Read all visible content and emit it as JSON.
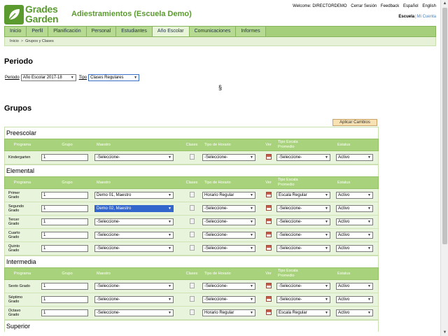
{
  "header": {
    "logo_line1": "Grades",
    "logo_line2": "Garden",
    "app_title": "Adiestramientos (Escuela Demo)",
    "welcome": "Welcome: DIRECTORDEMO",
    "logout": "Cerrar Sesión",
    "feedback": "Feedback",
    "lang_es": "Español",
    "lang_en": "English",
    "school_label": "Escuela",
    "account_label": "Mi Cuenta"
  },
  "nav": {
    "items": [
      {
        "label": "Inicio"
      },
      {
        "label": "Perfil"
      },
      {
        "label": "Planificación"
      },
      {
        "label": "Personal"
      },
      {
        "label": "Estudiantes"
      },
      {
        "label": "Año Escolar"
      },
      {
        "label": "Comunicaciones"
      },
      {
        "label": "Informes"
      }
    ],
    "active": "Año Escolar"
  },
  "breadcrumb": {
    "home": "Inicio",
    "current": "Grupos y Clases"
  },
  "periodo": {
    "heading": "Periodo",
    "periodo_label": "Periodo",
    "periodo_value": "Año Escolar 2017-18",
    "tipo_label": "Tipo",
    "tipo_value": "Clases Regulares",
    "section_mark": "§"
  },
  "grupos": {
    "heading": "Grupos",
    "apply_button": "Aplicar Cambios",
    "columns": {
      "programa": "Programa",
      "grupo": "Grupo",
      "maestro": "Maestro",
      "clases": "Clases",
      "tipo_horario": "Tipo de Horario",
      "ver": "Ver",
      "tipo_escala_1": "Tipo Escala",
      "tipo_escala_2": "Promedio",
      "estatus": "Estatus"
    },
    "levels": [
      {
        "title": "Preescolar",
        "rows": [
          {
            "p1": "Kindergarten",
            "p2": "",
            "grupo": "1",
            "maestro": "-Seleccione-",
            "horario": "-Seleccione-",
            "escala": "-Seleccione-",
            "estatus": "Activo",
            "hl": false
          }
        ]
      },
      {
        "title": "Elemental",
        "rows": [
          {
            "p1": "Primer",
            "p2": "Grado",
            "grupo": "1",
            "maestro": "Demo 01, Maestro",
            "horario": "Horario Regular",
            "escala": "Escala Regular",
            "estatus": "Activo",
            "hl": false
          },
          {
            "p1": "Segundo",
            "p2": "Grado",
            "grupo": "1",
            "maestro": "Demo 02, Maestro",
            "horario": "-Seleccione-",
            "escala": "-Seleccione-",
            "estatus": "Activo",
            "hl": true
          },
          {
            "p1": "Tercer",
            "p2": "Grado",
            "grupo": "1",
            "maestro": "-Seleccione-",
            "horario": "-Seleccione-",
            "escala": "-Seleccione-",
            "estatus": "Activo",
            "hl": false
          },
          {
            "p1": "Cuarto",
            "p2": "Grado",
            "grupo": "1",
            "maestro": "-Seleccione-",
            "horario": "-Seleccione-",
            "escala": "-Seleccione-",
            "estatus": "Activo",
            "hl": false
          },
          {
            "p1": "Quinto",
            "p2": "Grado",
            "grupo": "1",
            "maestro": "-Seleccione-",
            "horario": "-Seleccione-",
            "escala": "-Seleccione-",
            "estatus": "Activo",
            "hl": false
          }
        ]
      },
      {
        "title": "Intermedia",
        "rows": [
          {
            "p1": "Sexto Grado",
            "p2": "",
            "grupo": "1",
            "maestro": "-Seleccione-",
            "horario": "-Seleccione-",
            "escala": "-Seleccione-",
            "estatus": "Activo",
            "hl": false
          },
          {
            "p1": "Séptimo",
            "p2": "Grado",
            "grupo": "1",
            "maestro": "-Seleccione-",
            "horario": "-Seleccione-",
            "escala": "-Seleccione-",
            "estatus": "Activo",
            "hl": false
          },
          {
            "p1": "Octavo",
            "p2": "Grado",
            "grupo": "1",
            "maestro": "-Seleccione-",
            "horario": "Horario Regular",
            "escala": "Escala Regular",
            "estatus": "Activo",
            "hl": false
          }
        ]
      },
      {
        "title": "Superior",
        "rows": []
      }
    ]
  },
  "colors": {
    "brand_green": "#5a9a2f",
    "nav_green": "#a5cf7a",
    "header_row": "#a9d27c",
    "row_bg": "#e9f4dc",
    "select_highlight": "#3366cc"
  }
}
